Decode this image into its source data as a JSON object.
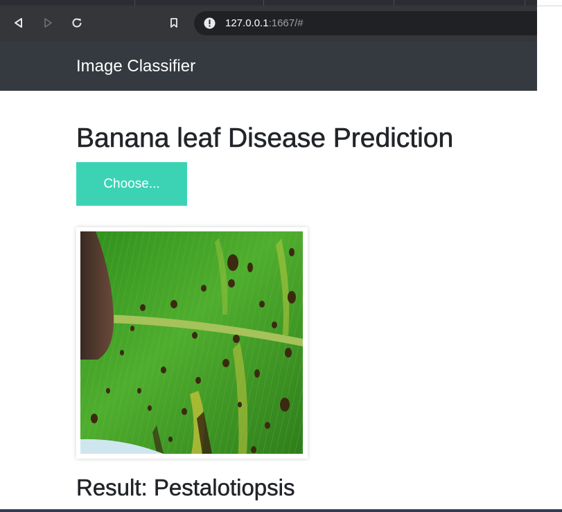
{
  "browser": {
    "url_host": "127.0.0.1",
    "url_rest": ":1667/#",
    "icons": {
      "back": "back-triangle-icon",
      "forward": "forward-triangle-icon",
      "reload": "reload-icon",
      "bookmark": "bookmark-icon",
      "site_info": "site-info-icon"
    }
  },
  "navbar": {
    "brand": "Image Classifier",
    "background": "#343a40"
  },
  "main": {
    "title": "Banana leaf Disease Prediction",
    "choose_label": "Choose...",
    "choose_color": "#3cd3b5",
    "result_text": "Result: Pestalotiopsis"
  }
}
